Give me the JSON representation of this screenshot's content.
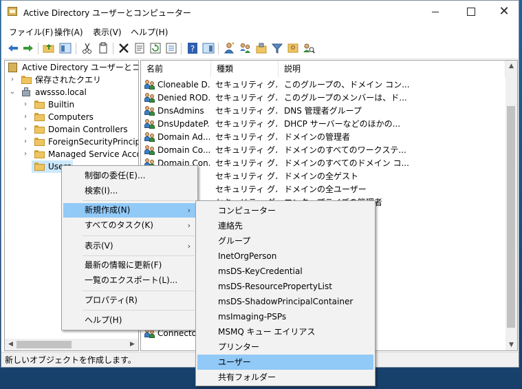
{
  "window": {
    "title": "Active Directory ユーザーとコンピューター"
  },
  "menubar": [
    "ファイル(F)",
    "操作(A)",
    "表示(V)",
    "ヘルプ(H)"
  ],
  "tree": {
    "root": "Active Directory ユーザーとコンピュー",
    "saved_queries": "保存されたクエリ",
    "domain": "awssso.local",
    "folders": [
      "Builtin",
      "Computers",
      "Domain Controllers",
      "ForeignSecurityPrincipals",
      "Managed Service Accounts",
      "Users"
    ]
  },
  "list": {
    "columns": [
      "名前",
      "種類",
      "説明"
    ],
    "rows": [
      {
        "name": "Cloneable D...",
        "type": "セキュリティ グル...",
        "desc": "このグループの、ドメイン コン..."
      },
      {
        "name": "Denied ROD...",
        "type": "セキュリティ グル...",
        "desc": "このグループのメンバーは、ド..."
      },
      {
        "name": "DnsAdmins",
        "type": "セキュリティ グル...",
        "desc": "DNS 管理者グループ"
      },
      {
        "name": "DnsUpdateP...",
        "type": "セキュリティ グル...",
        "desc": "DHCP サーバーなどのほかの..."
      },
      {
        "name": "Domain Ad...",
        "type": "セキュリティ グル...",
        "desc": "ドメインの管理者"
      },
      {
        "name": "Domain Co...",
        "type": "セキュリティ グル...",
        "desc": "ドメインのすべてのワークステ..."
      },
      {
        "name": "Domain Con...",
        "type": "セキュリティ グル...",
        "desc": "ドメインのすべてのドメイン コ..."
      },
      {
        "name": "",
        "type": "セキュリティ グル...",
        "desc": "ドメインの全ゲスト"
      },
      {
        "name": "rs",
        "type": "セキュリティ グル...",
        "desc": "ドメインの全ユーザー"
      },
      {
        "name": "",
        "type": "セキュリティ グル...",
        "desc": "エンタープライズの管理者"
      }
    ],
    "bottom_row_name": "Connector"
  },
  "context_menu": {
    "items": [
      "制御の委任(E)...",
      "検索(I)...",
      "新規作成(N)",
      "すべてのタスク(K)",
      "表示(V)",
      "最新の情報に更新(F)",
      "一覧のエクスポート(L)...",
      "プロパティ(R)",
      "ヘルプ(H)"
    ]
  },
  "submenu": {
    "items": [
      "コンピューター",
      "連絡先",
      "グループ",
      "InetOrgPerson",
      "msDS-KeyCredential",
      "msDS-ResourcePropertyList",
      "msDS-ShadowPrincipalContainer",
      "msImaging-PSPs",
      "MSMQ キュー エイリアス",
      "プリンター",
      "ユーザー",
      "共有フォルダー"
    ]
  },
  "status": "新しいオブジェクトを作成します。",
  "colors": {
    "highlight": "#91c9f7",
    "desktop": "#1b4f80"
  }
}
